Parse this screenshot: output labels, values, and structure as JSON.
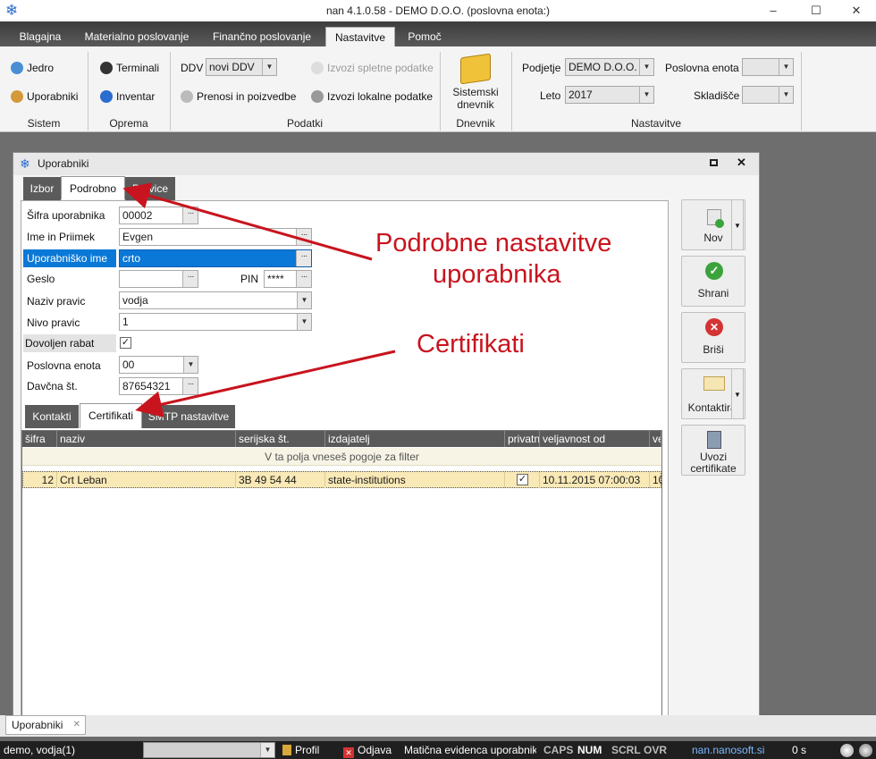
{
  "window": {
    "title": "nan 4.1.0.58 - DEMO D.O.O. (poslovna enota:)",
    "minimize": "–",
    "maximize": "☐",
    "close": "✕"
  },
  "menu": {
    "tabs": [
      "Blagajna",
      "Materialno poslovanje",
      "Finančno poslovanje",
      "Nastavitve",
      "Pomoč"
    ],
    "active": "Nastavitve"
  },
  "ribbon": {
    "sistem": {
      "jedro": "Jedro",
      "uporabniki": "Uporabniki",
      "group": "Sistem"
    },
    "oprema": {
      "terminali": "Terminali",
      "inventar": "Inventar",
      "group": "Oprema"
    },
    "podatki": {
      "ddv_label": "DDV",
      "ddv_value": "novi DDV",
      "prenosi": "Prenosi in poizvedbe",
      "izvozi_spletne": "Izvozi spletne podatke",
      "izvozi_lokalne": "Izvozi lokalne podatke",
      "group": "Podatki"
    },
    "dnevnik": {
      "line1": "Sistemski",
      "line2": "dnevnik",
      "group": "Dnevnik"
    },
    "nastavitve": {
      "podjetje_label": "Podjetje",
      "podjetje_value": "DEMO D.O.O.",
      "leto_label": "Leto",
      "leto_value": "2017",
      "poslovna_enota_label": "Poslovna enota",
      "skladisce_label": "Skladišče",
      "group": "Nastavitve"
    }
  },
  "dialog": {
    "title": "Uporabniki",
    "tabs": [
      "Izbor",
      "Podrobno",
      "Pravice"
    ],
    "active_tab": "Podrobno",
    "fields": {
      "sifra_label": "Šifra uporabnika",
      "sifra_value": "00002",
      "ime_label": "Ime in Priimek",
      "ime_value": "Evgen",
      "upor_label": "Uporabniško ime",
      "upor_value": "crto",
      "geslo_label": "Geslo",
      "geslo_value": "",
      "pin_label": "PIN",
      "pin_value": "****",
      "naziv_label": "Naziv pravic",
      "naziv_value": "vodja",
      "nivo_label": "Nivo pravic",
      "nivo_value": "1",
      "rabat_label": "Dovoljen rabat",
      "rabat_checked": "✓",
      "pe_label": "Poslovna enota",
      "pe_value": "00",
      "davcna_label": "Davčna št.",
      "davcna_value": "87654321"
    },
    "subtabs": [
      "Kontakti",
      "Certifikati",
      "SMTP nastavitve"
    ],
    "active_subtab": "Certifikati",
    "grid": {
      "columns": [
        "šifra",
        "naziv",
        "serijska št.",
        "izdajatelj",
        "privatn",
        "veljavnost od",
        "ve"
      ],
      "filter_hint": "V ta polja vneseš pogoje za filter",
      "rows": [
        {
          "sifra": "12",
          "naziv": "Crt Leban",
          "serijska": "3B 49 54 44",
          "izdajatelj": "state-institutions",
          "privatni": "✓",
          "veljavnost_od": "10.11.2015 07:00:03",
          "ve": "10"
        }
      ]
    },
    "buttons": {
      "nov": "Nov",
      "shrani": "Shrani",
      "brisi": "Briši",
      "kontaktiraj": "Kontaktiraj",
      "uvozi1": "Uvozi",
      "uvozi2": "certifikate"
    }
  },
  "annotations": {
    "a1_line1": "Podrobne nastavitve",
    "a1_line2": "uporabnika",
    "a2": "Certifikati",
    "color": "#c8141e"
  },
  "taskbar": {
    "tab": "Uporabniki",
    "close": "✕"
  },
  "status": {
    "user": "demo, vodja(1)",
    "profil": "Profil",
    "odjava": "Odjava",
    "info": "Matična evidenca uporabnik",
    "caps": "CAPS",
    "num": "NUM",
    "scrl": "SCRL",
    "ovr": "OVR",
    "site": "nan.nanosoft.si",
    "time": "0 s"
  }
}
